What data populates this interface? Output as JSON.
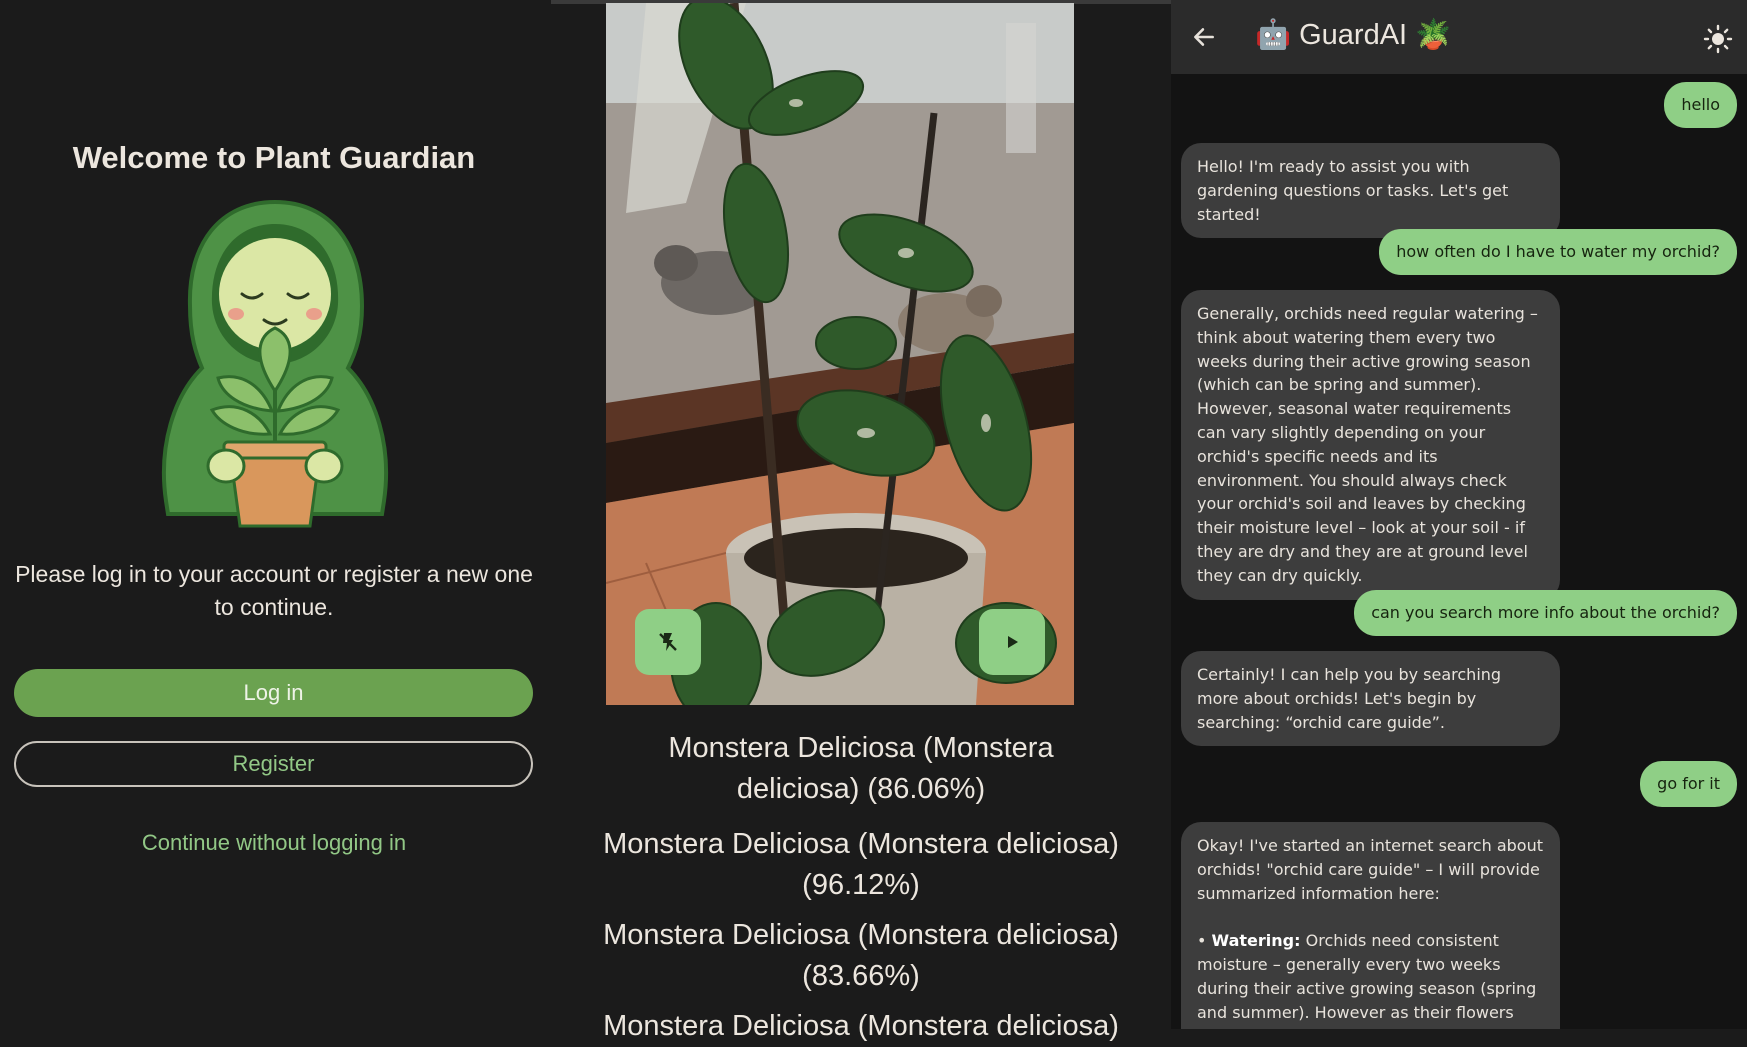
{
  "login": {
    "title": "Welcome to Plant Guardian",
    "subtitle": "Please log in to your account or register a new one to continue.",
    "login_button": "Log in",
    "register_button": "Register",
    "guest_link": "Continue without logging in"
  },
  "camera": {
    "flash_icon": "flash-off-icon",
    "play_icon": "play-icon",
    "results": [
      "Monstera Deliciosa (Monstera deliciosa)  (86.06%)",
      "Monstera Deliciosa (Monstera deliciosa) (96.12%)",
      "Monstera Deliciosa (Monstera deliciosa) (83.66%)",
      "Monstera Deliciosa (Monstera deliciosa)"
    ]
  },
  "chat": {
    "title": "GuardAI",
    "title_prefix_emoji": "🤖",
    "title_suffix_emoji": "🪴",
    "back_icon": "arrow-left-icon",
    "theme_icon": "sun-icon",
    "messages": [
      {
        "role": "user",
        "text": "hello"
      },
      {
        "role": "bot",
        "text": "Hello! I'm ready to assist you with gardening questions or tasks. Let's get started!"
      },
      {
        "role": "user",
        "text": "how often do I have to water my orchid?"
      },
      {
        "role": "bot",
        "text": "Generally, orchids need regular watering – think about watering them every two weeks during their active growing season (which can be spring and summer). However, seasonal water requirements can vary slightly depending on your orchid's specific needs and its environment. You should always check your orchid's soil and leaves by checking their moisture level – look at your soil - if they are dry and they are at ground level they can dry quickly."
      },
      {
        "role": "user",
        "text": "can you search more info about the orchid?"
      },
      {
        "role": "bot",
        "text": "Certainly! I can help you by searching more about orchids! Let's begin by searching: “orchid care guide”."
      },
      {
        "role": "user",
        "text": "go for it"
      },
      {
        "role": "bot",
        "intro": "Okay! I've started an internet search about orchids! \"orchid care guide\" – I will provide summarized information here:",
        "bullet_label": "Watering:",
        "bullet_text": "Orchids need consistent moisture – generally every two weeks during their active growing season (spring and summer). However as their flowers appear"
      }
    ]
  },
  "colors": {
    "accent": "#6ba250",
    "accent_light": "#8fcf86",
    "background": "#1b1b1b",
    "bot_bubble": "#3d3d3d"
  }
}
